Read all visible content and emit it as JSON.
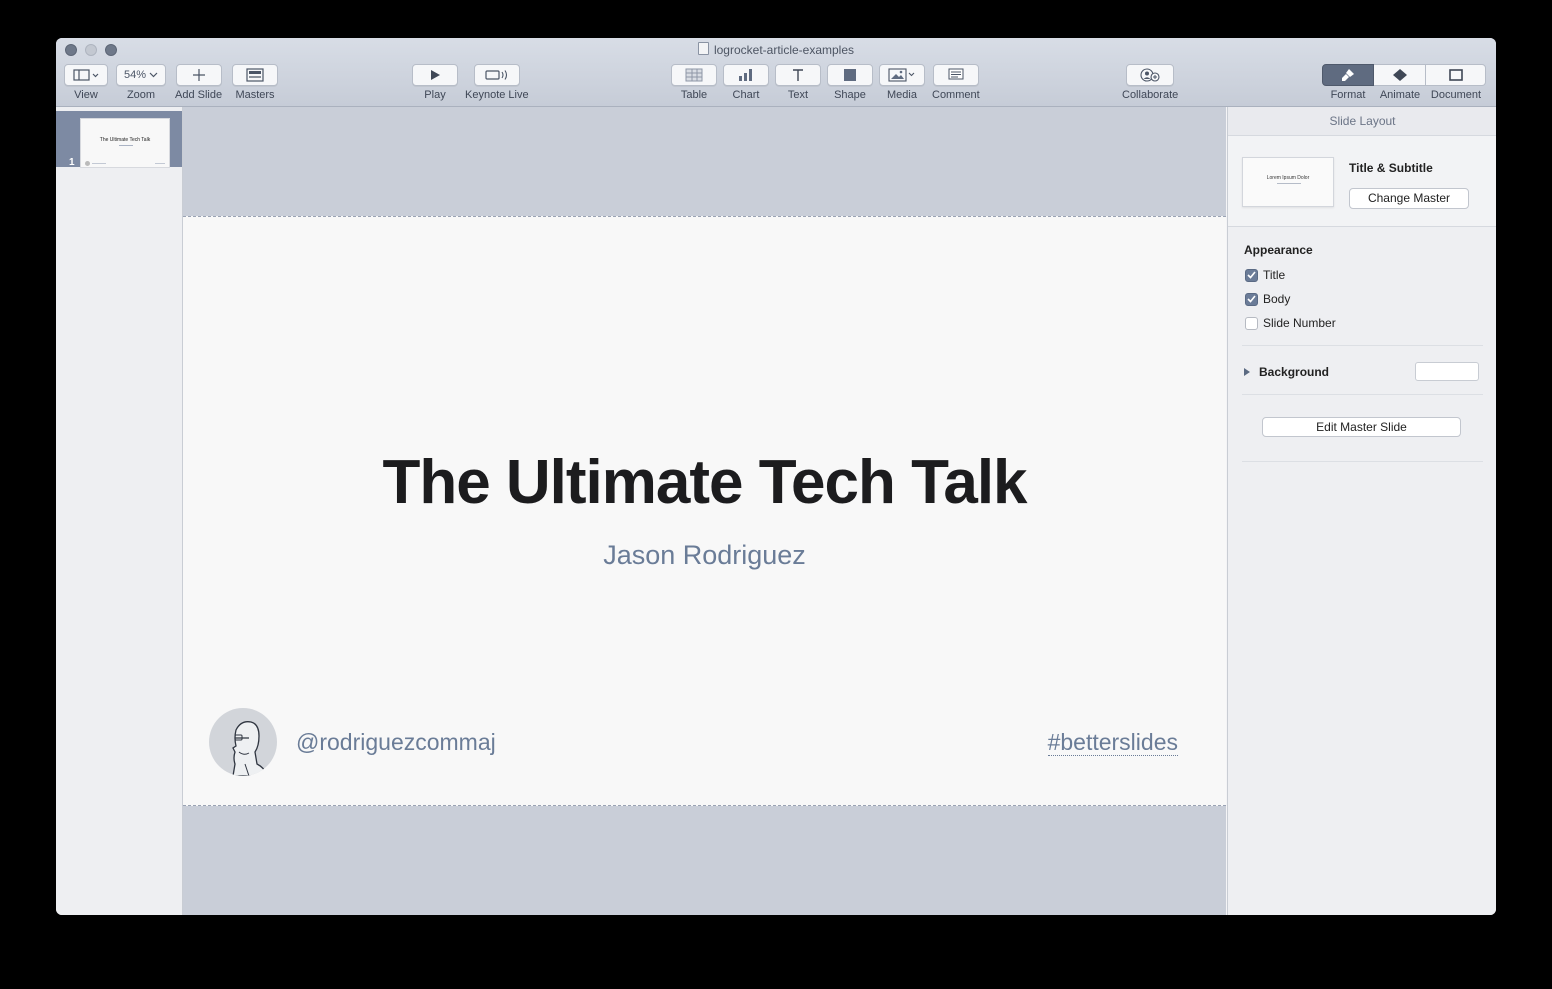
{
  "window": {
    "title": "logrocket-article-examples"
  },
  "toolbar": {
    "view_label": "View",
    "zoom_value": "54%",
    "zoom_label": "Zoom",
    "add_slide_label": "Add Slide",
    "masters_label": "Masters",
    "play_label": "Play",
    "keynote_live_label": "Keynote Live",
    "table_label": "Table",
    "chart_label": "Chart",
    "text_label": "Text",
    "shape_label": "Shape",
    "media_label": "Media",
    "comment_label": "Comment",
    "collaborate_label": "Collaborate",
    "format_label": "Format",
    "animate_label": "Animate",
    "document_label": "Document",
    "active_inspector": "Format"
  },
  "navigator": {
    "slides": [
      {
        "number": "1",
        "thumb_title": "The Ultimate Tech Talk",
        "selected": true
      }
    ]
  },
  "slide": {
    "title": "The Ultimate Tech Talk",
    "subtitle": "Jason Rodriguez",
    "handle": "@rodriguezcommaj",
    "hashtag": "#betterslides"
  },
  "inspector": {
    "header": "Slide Layout",
    "layout_name": "Title & Subtitle",
    "layout_thumb_text": "Lorem Ipsum Dolor",
    "change_master_label": "Change Master",
    "appearance_title": "Appearance",
    "checkboxes": [
      {
        "label": "Title",
        "checked": true
      },
      {
        "label": "Body",
        "checked": true
      },
      {
        "label": "Slide Number",
        "checked": false
      }
    ],
    "background_label": "Background",
    "edit_master_label": "Edit Master Slide"
  },
  "colors": {
    "accent": "#5f6b80",
    "subtitle_text": "#6a7c97",
    "canvas_bg": "#c9ced8",
    "checkbox_on": "#6b7c98"
  }
}
